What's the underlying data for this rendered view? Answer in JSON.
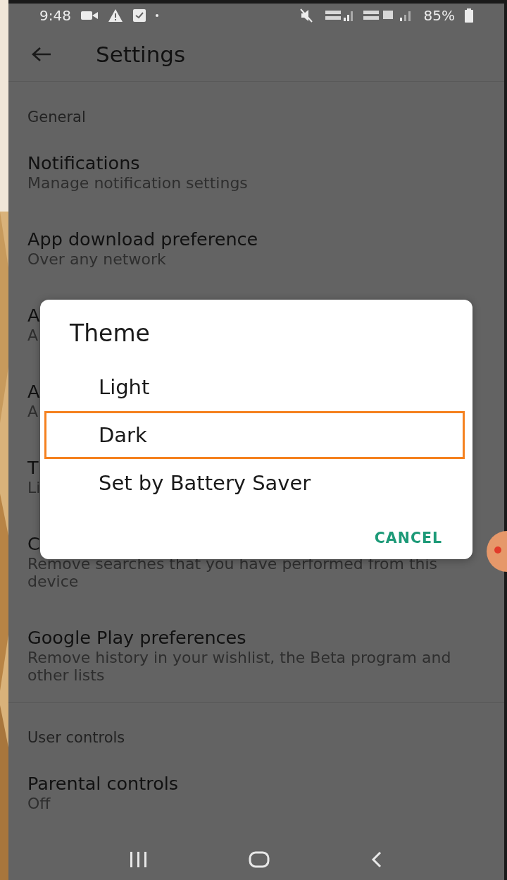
{
  "status_bar": {
    "time": "9:48",
    "battery": "85%"
  },
  "app_bar": {
    "title": "Settings"
  },
  "sections": [
    {
      "header": "General",
      "items": [
        {
          "title": "Notifications",
          "subtitle": "Manage notification settings"
        },
        {
          "title": "App download preference",
          "subtitle": "Over any network"
        },
        {
          "title": "A",
          "subtitle": "A"
        },
        {
          "title": "A",
          "subtitle": "A"
        },
        {
          "title": "T",
          "subtitle": "Li"
        },
        {
          "title": "C",
          "subtitle": "Remove searches that you have performed from this device"
        },
        {
          "title": "Google Play preferences",
          "subtitle": "Remove history in your wishlist, the Beta program and other lists"
        }
      ]
    },
    {
      "header": "User controls",
      "items": [
        {
          "title": "Parental controls",
          "subtitle": "Off"
        }
      ]
    }
  ],
  "dialog": {
    "title": "Theme",
    "options": [
      {
        "label": "Light",
        "highlighted": false
      },
      {
        "label": "Dark",
        "highlighted": true
      },
      {
        "label": "Set by Battery Saver",
        "highlighted": false
      }
    ],
    "action": "CANCEL"
  }
}
